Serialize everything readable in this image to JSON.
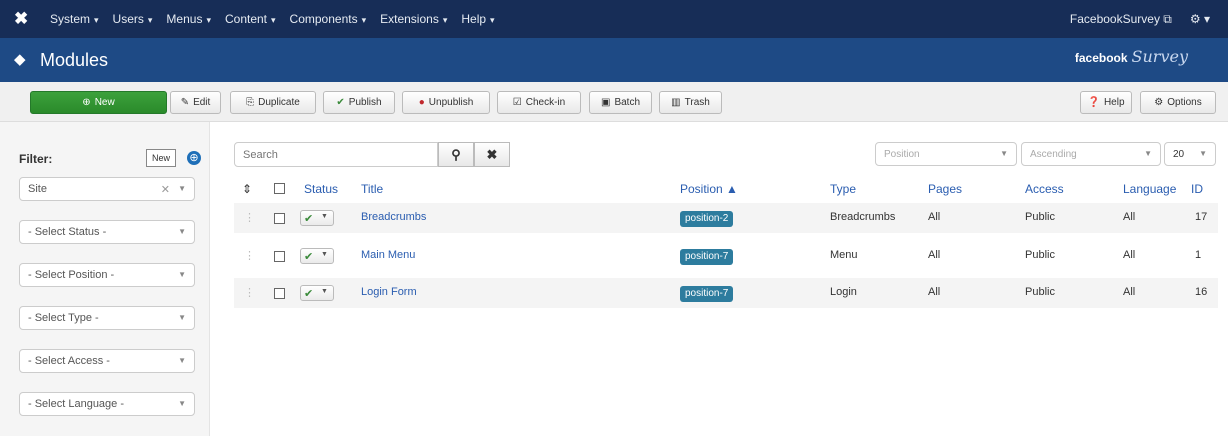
{
  "topbar": {
    "menus": [
      "System",
      "Users",
      "Menus",
      "Content",
      "Components",
      "Extensions",
      "Help"
    ],
    "site_link": "FacebookSurvey",
    "settings_caret": "▾"
  },
  "header": {
    "title": "Modules",
    "brand_bold": "facebook",
    "brand_script": "Survey"
  },
  "toolbar": {
    "new": "New",
    "edit": "Edit",
    "duplicate": "Duplicate",
    "publish": "Publish",
    "unpublish": "Unpublish",
    "checkin": "Check-in",
    "batch": "Batch",
    "trash": "Trash",
    "help": "Help",
    "options": "Options"
  },
  "sidebar": {
    "tooltip": "New",
    "filter_label": "Filter:",
    "selects": [
      {
        "value": "Site"
      },
      {
        "value": "- Select Status -"
      },
      {
        "value": "- Select Position -"
      },
      {
        "value": "- Select Type -"
      },
      {
        "value": "- Select Access -"
      },
      {
        "value": "- Select Language -"
      }
    ]
  },
  "search": {
    "placeholder": "Search"
  },
  "list_controls": {
    "ordering": "Position",
    "direction": "Ascending",
    "limit": "20"
  },
  "table": {
    "headers": {
      "status": "Status",
      "title": "Title",
      "position": "Position ▲",
      "type": "Type",
      "pages": "Pages",
      "access": "Access",
      "language": "Language",
      "id": "ID"
    },
    "rows": [
      {
        "title": "Breadcrumbs",
        "position": "position-2",
        "type": "Breadcrumbs",
        "pages": "All",
        "access": "Public",
        "language": "All",
        "id": "17"
      },
      {
        "title": "Main Menu",
        "position": "position-7",
        "type": "Menu",
        "pages": "All",
        "access": "Public",
        "language": "All",
        "id": "1"
      },
      {
        "title": "Login Form",
        "position": "position-7",
        "type": "Login",
        "pages": "All",
        "access": "Public",
        "language": "All",
        "id": "16"
      }
    ]
  }
}
